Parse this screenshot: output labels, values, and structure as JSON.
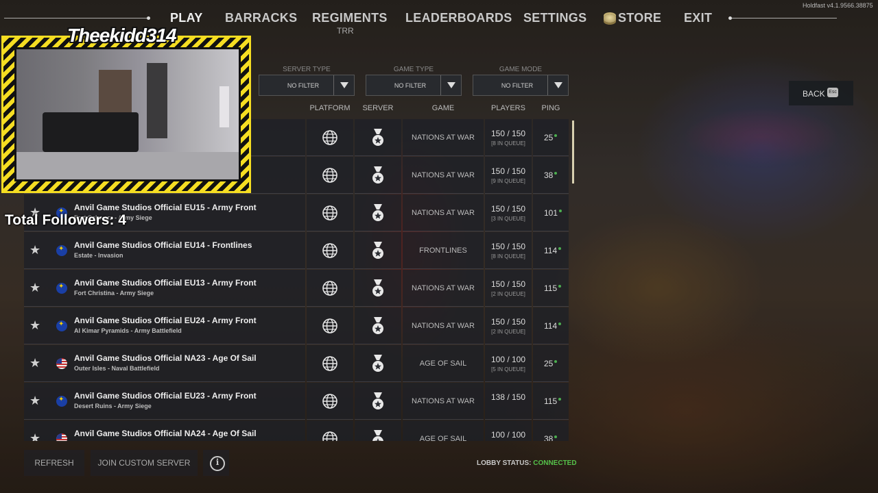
{
  "app": {
    "name": "Holdfast",
    "version": "v4.1.9566.38875"
  },
  "nav": {
    "items": [
      {
        "label": "PLAY",
        "active": true
      },
      {
        "label": "BARRACKS"
      },
      {
        "label": "REGIMENTS",
        "sub": "TRR"
      },
      {
        "label": "LEADERBOARDS"
      },
      {
        "label": "SETTINGS"
      },
      {
        "label": "STORE",
        "icon": "coins-icon"
      },
      {
        "label": "EXIT"
      }
    ]
  },
  "overlay": {
    "streamer_name": "Theekidd314",
    "followers_text": "Total Followers: 4"
  },
  "filters": [
    {
      "label": "SERVER TYPE",
      "value": "NO FILTER"
    },
    {
      "label": "GAME TYPE",
      "value": "NO FILTER"
    },
    {
      "label": "GAME MODE",
      "value": "NO FILTER"
    }
  ],
  "back": {
    "label": "BACK",
    "key": "Esc"
  },
  "table": {
    "columns": {
      "platform": "PLATFORM",
      "server": "SERVER",
      "game": "GAME",
      "players": "PLAYERS",
      "ping": "PING"
    },
    "rows": [
      {
        "name": "",
        "map": "",
        "flag": "eu",
        "game": "NATIONS AT WAR",
        "players": "150 / 150",
        "queue": "[8 IN QUEUE]",
        "ping": "25"
      },
      {
        "name": "",
        "map": "",
        "flag": "eu",
        "game": "NATIONS AT WAR",
        "players": "150 / 150",
        "queue": "[9 IN QUEUE]",
        "ping": "38"
      },
      {
        "name": "Anvil Game Studios Official EU15 - Army Front",
        "map": "Fort Schwarz - Army Siege",
        "flag": "eu",
        "game": "NATIONS AT WAR",
        "players": "150 / 150",
        "queue": "[3 IN QUEUE]",
        "ping": "101"
      },
      {
        "name": "Anvil Game Studios Official EU14 - Frontlines",
        "map": "Estate - Invasion",
        "flag": "eu",
        "game": "FRONTLINES",
        "players": "150 / 150",
        "queue": "[8 IN QUEUE]",
        "ping": "114"
      },
      {
        "name": "Anvil Game Studios Official EU13 - Army Front",
        "map": "Fort Christina - Army Siege",
        "flag": "eu",
        "game": "NATIONS AT WAR",
        "players": "150 / 150",
        "queue": "[2 IN QUEUE]",
        "ping": "115"
      },
      {
        "name": "Anvil Game Studios Official EU24 - Army Front",
        "map": "Al Kimar Pyramids - Army Battlefield",
        "flag": "eu",
        "game": "NATIONS AT WAR",
        "players": "150 / 150",
        "queue": "[2 IN QUEUE]",
        "ping": "114"
      },
      {
        "name": "Anvil Game Studios Official NA23 - Age Of Sail",
        "map": "Outer Isles - Naval Battlefield",
        "flag": "us",
        "game": "AGE OF SAIL",
        "players": "100 / 100",
        "queue": "[5 IN QUEUE]",
        "ping": "25"
      },
      {
        "name": "Anvil Game Studios Official EU23 - Army Front",
        "map": "Desert Ruins - Army Siege",
        "flag": "eu",
        "game": "NATIONS AT WAR",
        "players": "138 / 150",
        "queue": "",
        "ping": "115"
      },
      {
        "name": "Anvil Game Studios Official NA24 - Age Of Sail",
        "map": "",
        "flag": "us",
        "game": "AGE OF SAIL",
        "players": "100 / 100",
        "queue": "",
        "ping": "38"
      }
    ]
  },
  "bottom": {
    "refresh": "REFRESH",
    "join_custom": "JOIN CUSTOM SERVER",
    "lobby_label": "LOBBY STATUS:",
    "lobby_value": "CONNECTED"
  },
  "colors": {
    "accent_yellow": "#f5dd22",
    "status_green": "#55c24a"
  }
}
